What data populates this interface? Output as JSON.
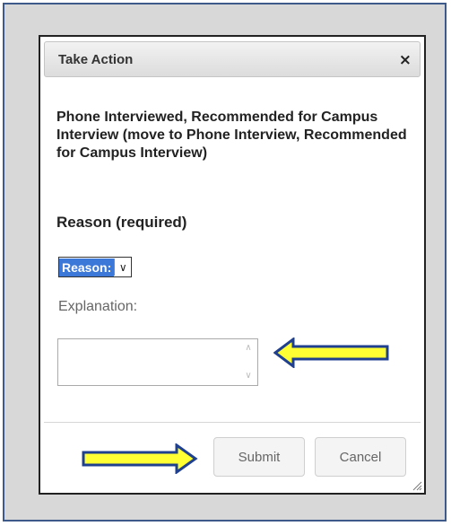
{
  "dialog": {
    "title": "Take Action",
    "close_icon": "×",
    "action_description": "Phone Interviewed, Recommended for Campus Interview (move to Phone Interview, Recommended for Campus Interview)",
    "reason_heading": "Reason (required)",
    "reason_select": {
      "selected_value": "Reason:"
    },
    "explanation_label": "Explanation:",
    "explanation_value": "",
    "buttons": {
      "submit_label": "Submit",
      "cancel_label": "Cancel"
    }
  },
  "icons": {
    "close": "close-icon",
    "select_arrow": "chevron-down-icon",
    "scroll_up": "chevron-up-icon",
    "scroll_down": "chevron-down-icon",
    "resize": "resize-handle-icon",
    "annotation_arrow": "arrow-left-icon / arrow-right-icon"
  },
  "colors": {
    "frame_border": "#3d5a8a",
    "select_highlight": "#3b78d8",
    "annotation_arrow_fill": "#ffff33",
    "annotation_arrow_stroke": "#1f3f8f"
  }
}
